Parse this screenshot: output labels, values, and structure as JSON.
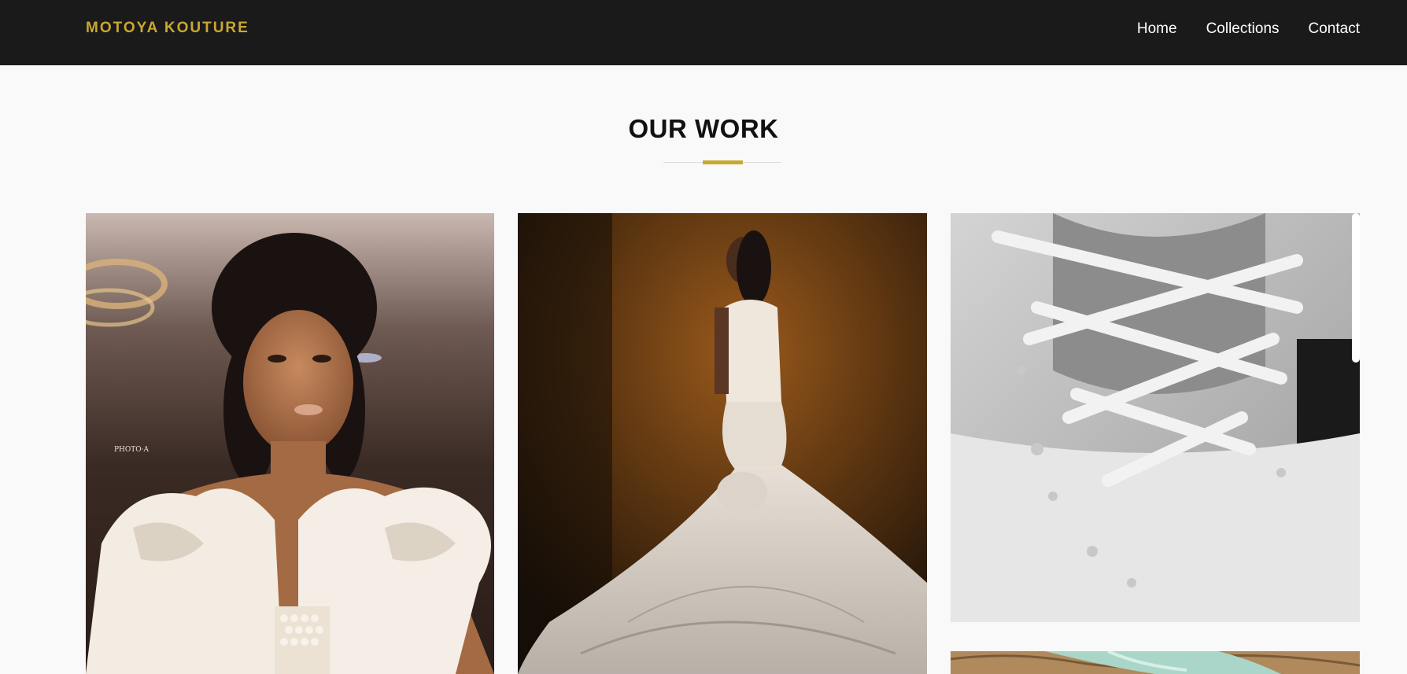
{
  "nav": {
    "brand": "MOTOYA KOUTURE",
    "links": [
      {
        "label": "Home"
      },
      {
        "label": "Collections"
      },
      {
        "label": "Contact"
      }
    ]
  },
  "section": {
    "title": "OUR WORK"
  },
  "gallery": {
    "photo1_watermark": "PHOTO·A"
  },
  "colors": {
    "accent": "#c9a830",
    "navbar": "#1a1a1a",
    "page_bg": "#f9f9fa"
  }
}
